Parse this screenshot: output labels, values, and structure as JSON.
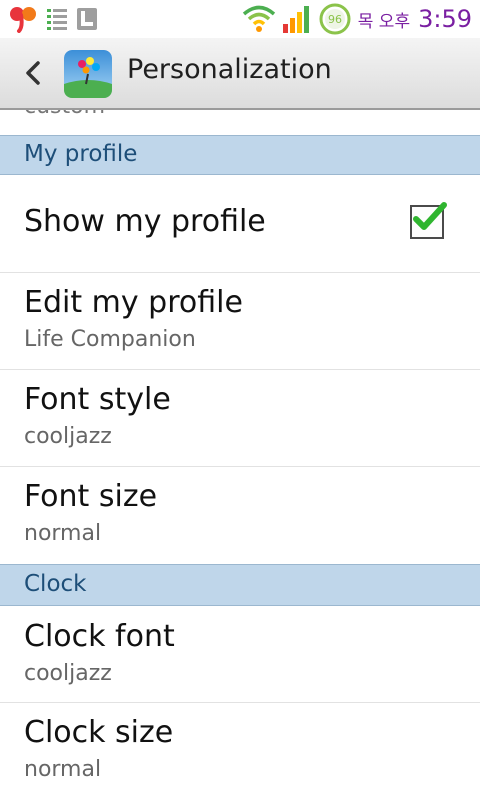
{
  "status_bar": {
    "korean_label": "목 오후",
    "time": "3:59",
    "battery_level": "96",
    "icons": [
      "carrier-logo-icon",
      "notification-list-icon",
      "notification-app-icon",
      "wifi-icon",
      "signal-bars-icon",
      "battery-icon"
    ]
  },
  "action_bar": {
    "title": "Personalization",
    "back_icon": "chevron-left-icon",
    "app_icon": "app-icon"
  },
  "cutoff_text": "custom",
  "sections": [
    {
      "label": "My profile"
    },
    {
      "label": "Clock"
    }
  ],
  "items": {
    "show_profile": {
      "title": "Show my profile",
      "checked": true
    },
    "edit_profile": {
      "title": "Edit my profile",
      "summary": "Life Companion"
    },
    "font_style": {
      "title": "Font style",
      "summary": "cooljazz"
    },
    "font_size": {
      "title": "Font size",
      "summary": "normal"
    },
    "clock_font": {
      "title": "Clock font",
      "summary": "cooljazz"
    },
    "clock_size": {
      "title": "Clock size",
      "summary": "normal"
    }
  },
  "colors": {
    "section_bg": "#bfd6ea",
    "section_text": "#1d4e78",
    "check_mark": "#2fb52f",
    "time_text": "#7a1fa2"
  }
}
